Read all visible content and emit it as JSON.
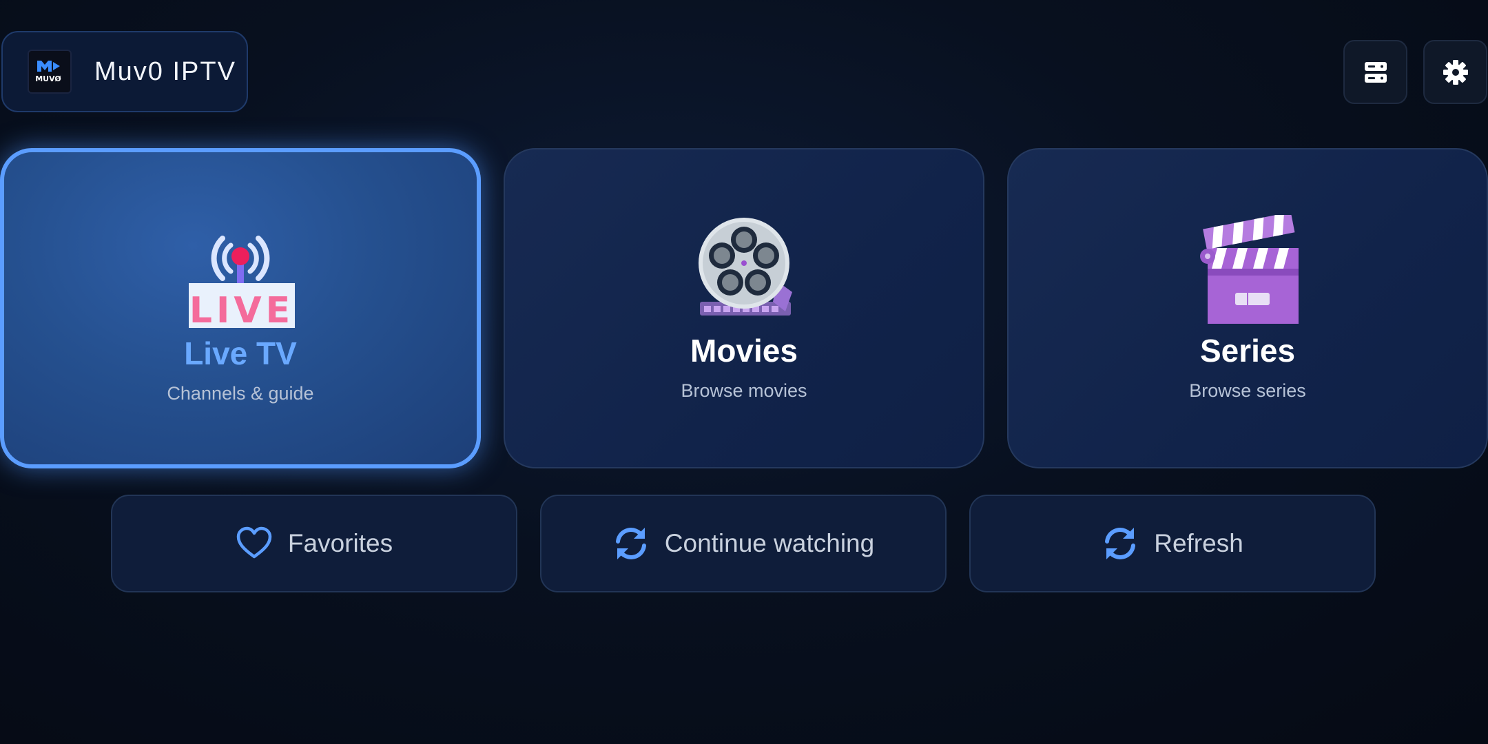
{
  "brand": {
    "name": "Muv0 IPTV",
    "logo_text": "MUVØ"
  },
  "top_actions": [
    {
      "icon": "server-icon",
      "name": "server-button"
    },
    {
      "icon": "gear-icon",
      "name": "settings-button"
    }
  ],
  "cards": [
    {
      "title": "Live TV",
      "subtitle": "Channels & guide",
      "icon": "live-broadcast-icon",
      "focused": true,
      "icon_text": "LIVE"
    },
    {
      "title": "Movies",
      "subtitle": "Browse movies",
      "icon": "film-reel-icon",
      "focused": false
    },
    {
      "title": "Series",
      "subtitle": "Browse series",
      "icon": "clapperboard-icon",
      "focused": false
    }
  ],
  "actions": [
    {
      "label": "Favorites",
      "icon": "heart-icon"
    },
    {
      "label": "Continue watching",
      "icon": "refresh-icon"
    },
    {
      "label": "Refresh",
      "icon": "refresh-icon"
    }
  ],
  "colors": {
    "accent": "#5b9dff",
    "card": "#132650",
    "background": "#060c18",
    "purple": "#a764d6"
  }
}
